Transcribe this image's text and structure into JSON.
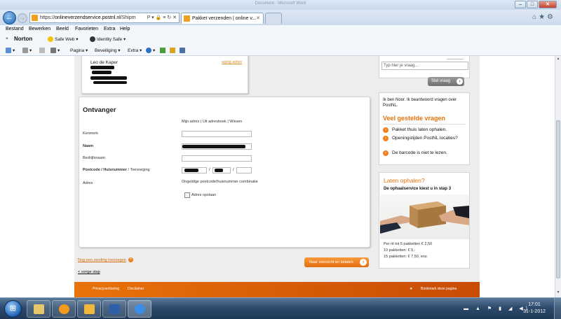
{
  "window": {
    "title": "Document - Microsoft Word"
  },
  "browser": {
    "url_prefix": "https://",
    "url_host": "onlineverzendservice.postnl.nl",
    "url_path": "/Shipm",
    "tab_title": "Pakket verzenden | online v...",
    "address_tools": "P ▾ 🔒 ≡ ↻ ✕"
  },
  "menu": [
    "Bestand",
    "Bewerken",
    "Beeld",
    "Favorieten",
    "Extra",
    "Help"
  ],
  "norton": {
    "close": "×",
    "brand": "Norton",
    "safe_web": "Safe Web",
    "identity_safe": "Identity Safe"
  },
  "commandbar": {
    "pagina": "Pagina",
    "beveiliging": "Beveiliging",
    "extra": "Extra"
  },
  "sender": {
    "name": "Leo de Kaper",
    "change_link": "wijzig adres"
  },
  "form": {
    "title": "Ontvanger",
    "links": "Mijn adres | Uit adresboek | Wissen",
    "labels": {
      "kenmerk": "Kenmerk",
      "naam": "Naam",
      "bedrijfsnaam": "Bedrijfsnaam",
      "postcode": "Postcode / Huisnummer",
      "toevoeging": " / Toevoeging",
      "adres": "Adres"
    },
    "separator": "/",
    "error_message": "Ongeldige postcode/huisnummer combinatie",
    "save_label": "Adres opslaan",
    "new_shipment_link": "Nog een zending toevoegen",
    "previous_link": "< vorige stap",
    "continue_button": "Naar overzicht en betalen"
  },
  "sidebar": {
    "search_placeholder": "Typ hier je vraag...",
    "ask_button": "Stel vraag",
    "intro": "Ik ben Noor. Ik beantwoord vragen over PostNL.",
    "faq_title": "Veel gestelde vragen",
    "faq": [
      "Pakket thuis laten ophalen.",
      "Openingstijden PostNL locaties?",
      "De barcode is niet te lezen."
    ],
    "pickup_title": "Laten ophalen?",
    "pickup_subtitle": "De ophaalservice kiest u in stap 3",
    "prices": [
      "Per rit tot 5 pakketten € 2,50",
      "10 pakketten: € 5,-",
      "15 pakketten: € 7,50, enz."
    ]
  },
  "footer": {
    "privacy": "Privacyverklaring",
    "disclaimer": "Disclaimer",
    "bookmark": "Bookmark deze pagina"
  },
  "taskbar": {
    "time": "17:01",
    "date": "31-1-2012"
  },
  "colors": {
    "accent": "#e8730a",
    "page_bg": "#ededed",
    "taskbar": "#2d4a6c"
  }
}
